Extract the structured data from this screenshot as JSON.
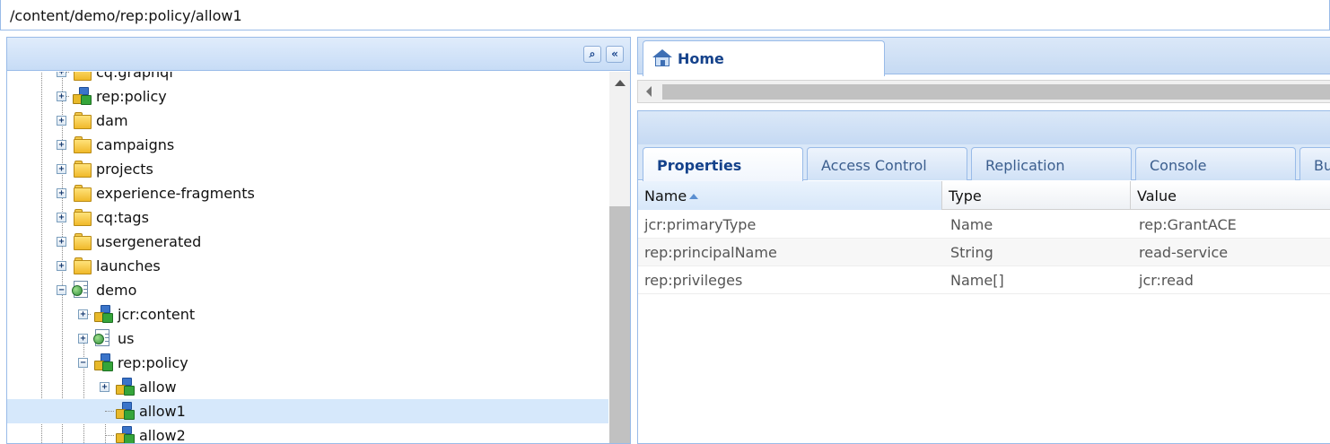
{
  "path": "/content/demo/rep:policy/allow1",
  "tree": {
    "items": [
      {
        "label": "cq:graphql"
      },
      {
        "label": "rep:policy"
      },
      {
        "label": "dam"
      },
      {
        "label": "campaigns"
      },
      {
        "label": "projects"
      },
      {
        "label": "experience-fragments"
      },
      {
        "label": "cq:tags"
      },
      {
        "label": "usergenerated"
      },
      {
        "label": "launches"
      },
      {
        "label": "demo"
      },
      {
        "label": "jcr:content"
      },
      {
        "label": "us"
      },
      {
        "label": "rep:policy"
      },
      {
        "label": "allow"
      },
      {
        "label": "allow1"
      },
      {
        "label": "allow2"
      }
    ],
    "selected": "allow1"
  },
  "tabs": {
    "home": "Home"
  },
  "props_tabs": [
    "Properties",
    "Access Control",
    "Replication",
    "Console",
    "Bu"
  ],
  "grid": {
    "headers": [
      "Name",
      "Type",
      "Value"
    ],
    "rows": [
      [
        "jcr:primaryType",
        "Name",
        "rep:GrantACE"
      ],
      [
        "rep:principalName",
        "String",
        "read-service"
      ],
      [
        "rep:privileges",
        "Name[]",
        "jcr:read"
      ]
    ]
  }
}
